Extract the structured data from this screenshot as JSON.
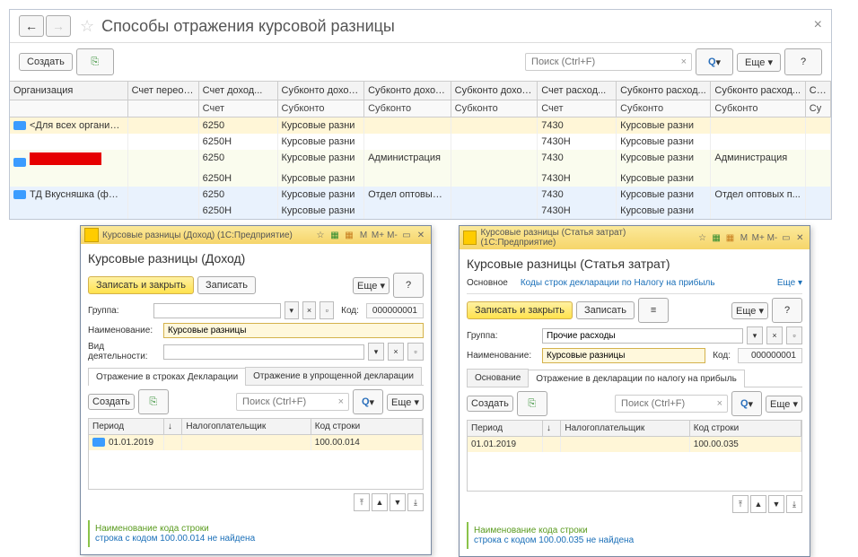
{
  "header": {
    "title": "Способы отражения курсовой разницы"
  },
  "toolbar": {
    "create_label": "Создать",
    "search_placeholder": "Поиск (Ctrl+F)",
    "more_label": "Еще",
    "help_label": "?"
  },
  "table": {
    "columns": [
      "Организация",
      "Счет переоценки",
      "Счет доход...",
      "Субконто доход...",
      "Субконто доход...",
      "Субконто доход...",
      "Счет расход...",
      "Субконто расход...",
      "Субконто расход...",
      "Су..."
    ],
    "subcolumns": [
      "",
      "",
      "Счет",
      "Субконто",
      "Субконто",
      "Субконто",
      "Счет",
      "Субконто",
      "Субконто",
      "Су"
    ],
    "rows": [
      {
        "org": "<Для всех организаций>",
        "r1": [
          "6250",
          "Курсовые разни",
          "",
          "",
          "7430",
          "Курсовые разни",
          "",
          ""
        ],
        "r2": [
          "6250Н",
          "Курсовые разни",
          "",
          "",
          "7430Н",
          "Курсовые разни",
          "",
          ""
        ],
        "highlight": true
      },
      {
        "org": "__RED__",
        "r1": [
          "6250",
          "Курсовые разни",
          "Администрация",
          "",
          "7430",
          "Курсовые разни",
          "Администрация",
          ""
        ],
        "r2": [
          "6250Н",
          "Курсовые разни",
          "",
          "",
          "7430Н",
          "Курсовые разни",
          "",
          ""
        ]
      },
      {
        "org": "ТД Вкусняшка (филиал \"ТД ...",
        "r1": [
          "6250",
          "Курсовые разни",
          "Отдел оптовых п...",
          "",
          "7430",
          "Курсовые разни",
          "Отдел оптовых п...",
          ""
        ],
        "r2": [
          "6250Н",
          "Курсовые разни",
          "",
          "",
          "7430Н",
          "Курсовые разни",
          "",
          ""
        ],
        "blue": true
      }
    ]
  },
  "dialog_left": {
    "win_title": "Курсовые разницы (Доход) (1С:Предприятие)",
    "heading": "Курсовые разницы (Доход)",
    "save_close": "Записать и закрыть",
    "save": "Записать",
    "more": "Еще",
    "help": "?",
    "group_label": "Группа:",
    "name_label": "Наименование:",
    "name_value": "Курсовые разницы",
    "activity_label": "Вид деятельности:",
    "code_label": "Код:",
    "code_value": "000000001",
    "tab1": "Отражение в строках Декларации",
    "tab2": "Отражение в упрощенной декларации",
    "create": "Создать",
    "search_ph": "Поиск (Ctrl+F)",
    "col_period": "Период",
    "col_tax": "Налогоплательщик",
    "col_code": "Код строки",
    "row_period": "01.01.2019",
    "row_code": "100.00.014",
    "foot_t1": "Наименование кода строки",
    "foot_t2": "строка с кодом 100.00.014 не найдена"
  },
  "dialog_right": {
    "win_title": "Курсовые разницы (Статья затрат) (1С:Предприятие)",
    "heading": "Курсовые разницы (Статья затрат)",
    "nav_main": "Основное",
    "nav_link": "Коды строк декларации по Налогу на прибыль",
    "save_close": "Записать и закрыть",
    "save": "Записать",
    "more": "Еще",
    "help": "?",
    "group_label": "Группа:",
    "group_value": "Прочие расходы",
    "name_label": "Наименование:",
    "name_value": "Курсовые разницы",
    "code_label": "Код:",
    "code_value": "000000001",
    "tab1": "Основание",
    "tab2": "Отражение в декларации по налогу на прибыль",
    "create": "Создать",
    "search_ph": "Поиск (Ctrl+F)",
    "col_period": "Период",
    "col_tax": "Налогоплательщик",
    "col_code": "Код строки",
    "row_period": "01.01.2019",
    "row_code": "100.00.035",
    "foot_t1": "Наименование кода строки",
    "foot_t2": "строка с кодом 100.00.035 не найдена"
  }
}
